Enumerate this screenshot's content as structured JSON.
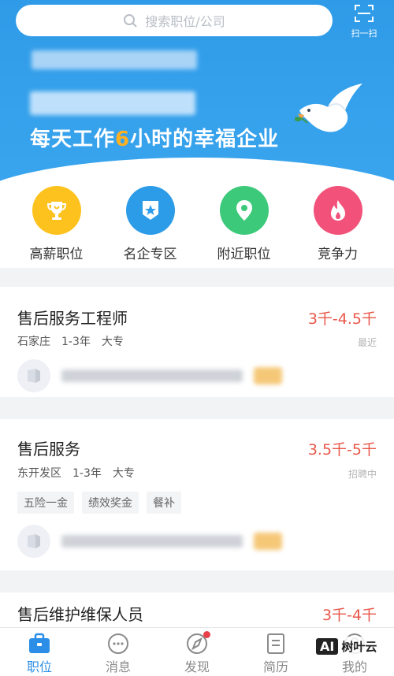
{
  "search": {
    "placeholder": "搜索职位/公司"
  },
  "scan": {
    "label": "扫一扫"
  },
  "banner": {
    "title_prefix": "每天工作",
    "title_highlight": "6",
    "title_suffix": "小时的幸福企业"
  },
  "quick_links": [
    {
      "label": "高薪职位",
      "icon": "trophy-icon",
      "color": "#fdc21e"
    },
    {
      "label": "名企专区",
      "icon": "star-badge-icon",
      "color": "#2d9ce8"
    },
    {
      "label": "附近职位",
      "icon": "location-pin-icon",
      "color": "#3dc97a"
    },
    {
      "label": "竞争力",
      "icon": "flame-icon",
      "color": "#f2527a"
    }
  ],
  "jobs": [
    {
      "title": "售后服务工程师",
      "salary": "3千-4.5千",
      "location": "石家庄",
      "experience": "1-3年",
      "education": "大专",
      "status": "最近",
      "tags": []
    },
    {
      "title": "售后服务",
      "salary": "3.5千-5千",
      "location": "东开发区",
      "experience": "1-3年",
      "education": "大专",
      "status": "招聘中",
      "tags": [
        "五险一金",
        "绩效奖金",
        "餐补"
      ]
    },
    {
      "title": "售后维护维保人员",
      "salary": "3千-4千"
    }
  ],
  "tabs": [
    {
      "label": "职位",
      "icon": "briefcase-icon",
      "active": true
    },
    {
      "label": "消息",
      "icon": "chat-bubble-icon"
    },
    {
      "label": "发现",
      "icon": "compass-icon"
    },
    {
      "label": "简历",
      "icon": "resume-icon"
    },
    {
      "label": "我的",
      "icon": "profile-icon"
    }
  ],
  "watermark": {
    "badge": "AI",
    "text": "树叶云"
  },
  "colors": {
    "primary": "#2c8ee6",
    "salary": "#e8574a",
    "banner": "#3aa5ee"
  }
}
